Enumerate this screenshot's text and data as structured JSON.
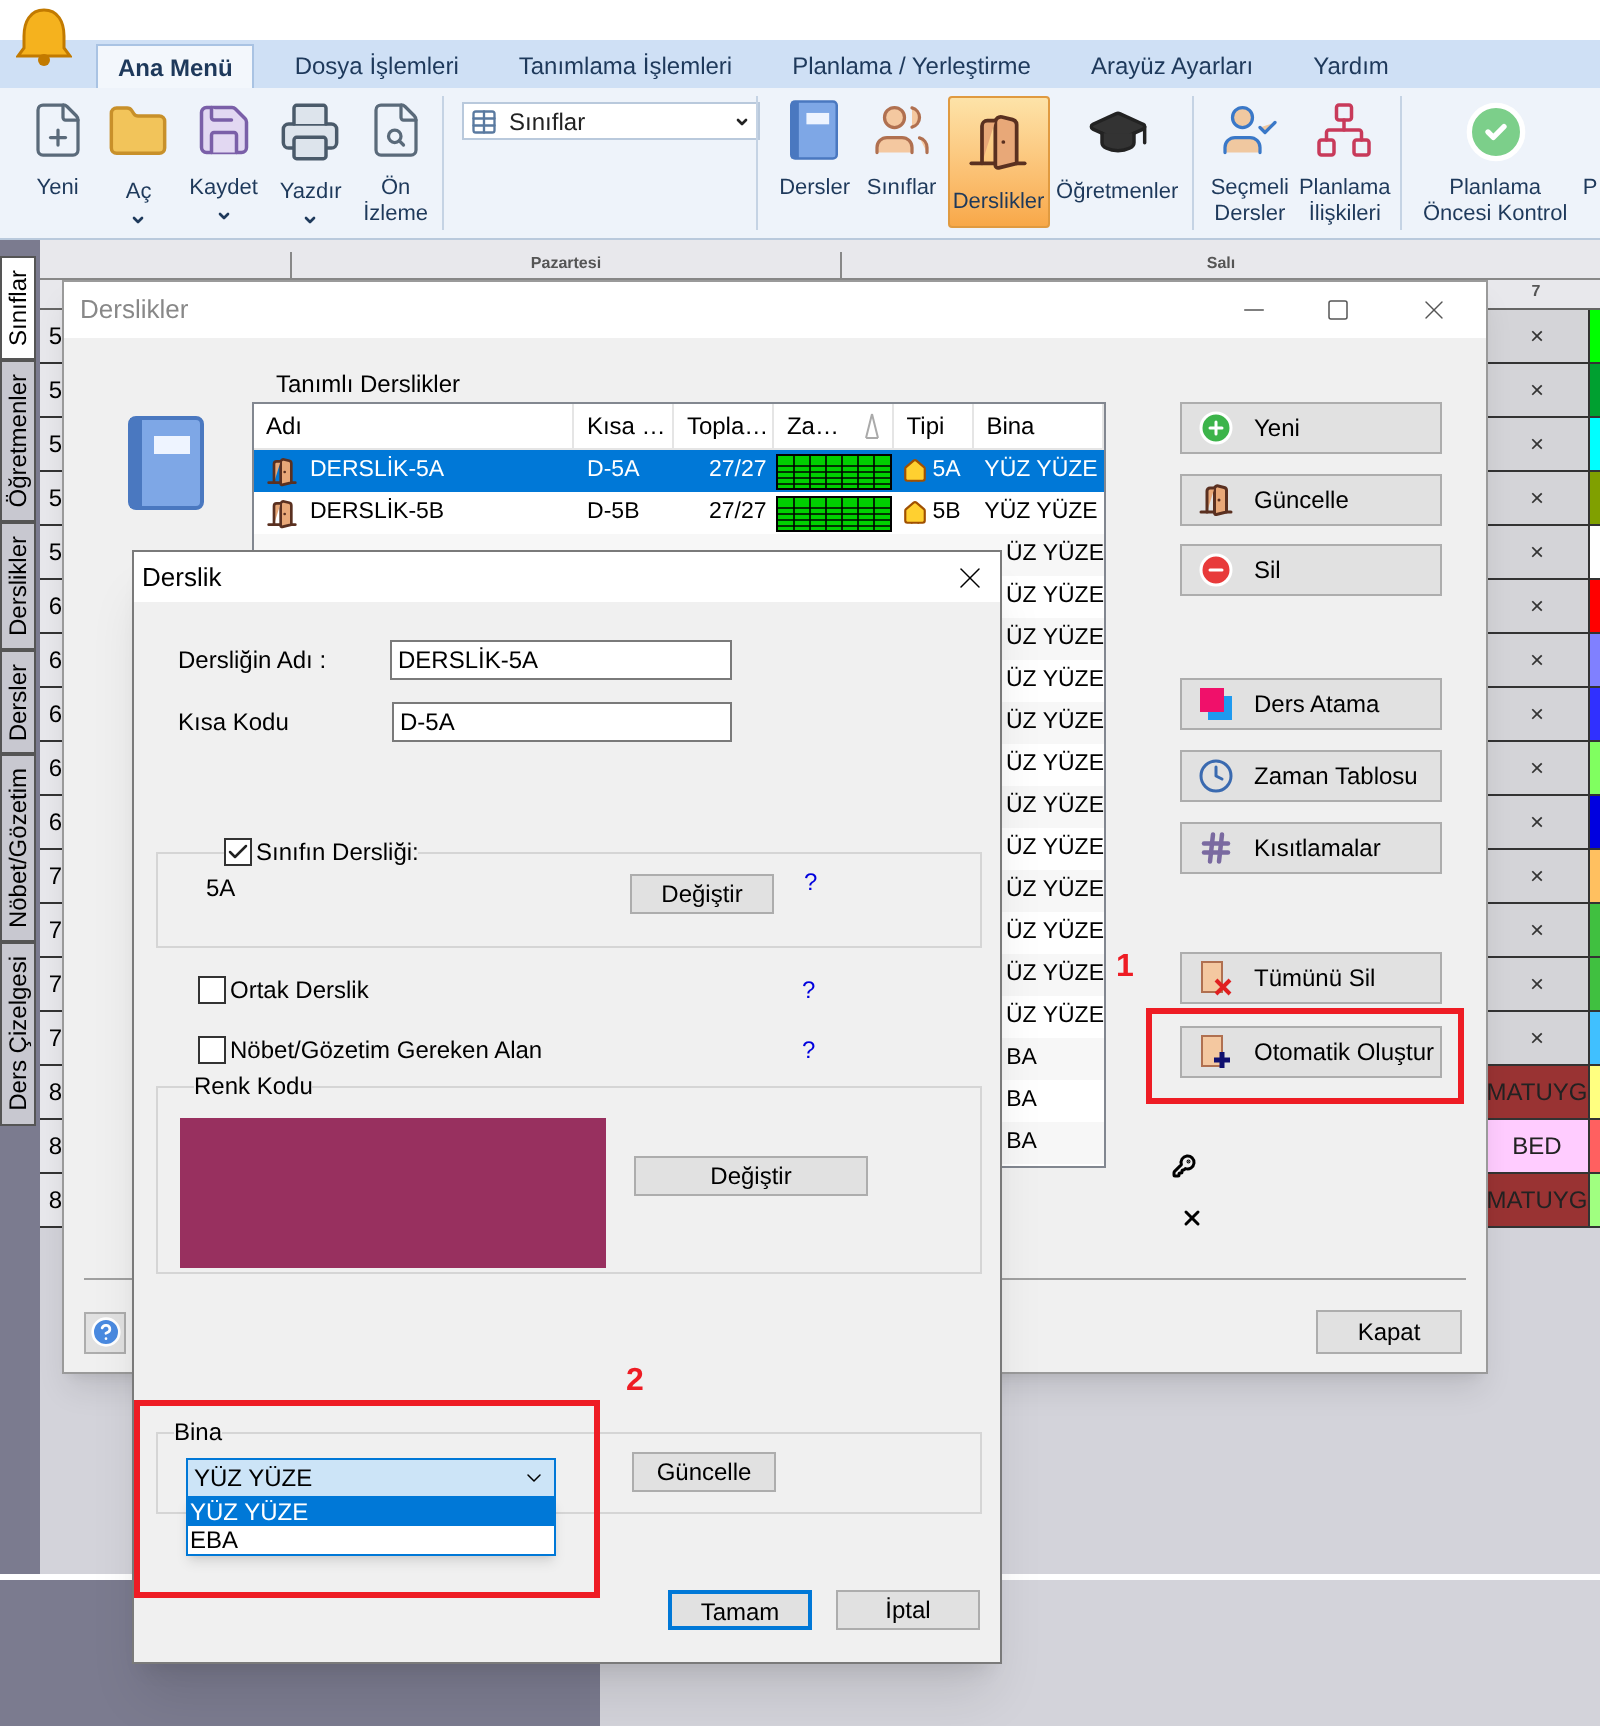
{
  "app_tabs": [
    {
      "label": "Ana Menü",
      "selected": true
    },
    {
      "label": "Dosya İşlemleri",
      "selected": false
    },
    {
      "label": "Tanımlama İşlemleri",
      "selected": false
    },
    {
      "label": "Planlama / Yerleştirme",
      "selected": false
    },
    {
      "label": "Arayüz Ayarları",
      "selected": false
    },
    {
      "label": "Yardım",
      "selected": false
    }
  ],
  "ribbon": {
    "file_tools": [
      {
        "label": "Yeni",
        "dropdown": false
      },
      {
        "label": "Aç",
        "dropdown": true
      },
      {
        "label": "Kaydet",
        "dropdown": true
      },
      {
        "label": "Yazdır",
        "dropdown": true
      },
      {
        "label": "Ön\nİzleme",
        "dropdown": false
      }
    ],
    "view_select": {
      "value": "Sınıflar"
    },
    "data_tools": [
      {
        "label": "Dersler",
        "selected": false
      },
      {
        "label": "Sınıflar",
        "selected": false
      },
      {
        "label": "Derslikler",
        "selected": true
      },
      {
        "label": "Öğretmenler",
        "selected": false
      }
    ],
    "plan_tools": [
      {
        "label": "Seçmeli\nDersler"
      },
      {
        "label": "Planlama\nİlişkileri"
      }
    ],
    "check_tools": [
      {
        "label": "Planlama\nÖncesi Kontrol"
      },
      {
        "label": "P"
      }
    ]
  },
  "side_tabs": [
    {
      "label": "Sınıflar",
      "selected": true
    },
    {
      "label": "Öğretmenler",
      "selected": false
    },
    {
      "label": "Derslikler",
      "selected": false
    },
    {
      "label": "Dersler",
      "selected": false
    },
    {
      "label": "Nöbet/Gözetim",
      "selected": false
    },
    {
      "label": "Ders Çizelgesi",
      "selected": false
    }
  ],
  "timetable": {
    "days": [
      "Pazartesi",
      "Salı"
    ],
    "period": "7",
    "rows": [
      {
        "number": "5",
        "kind": "empty",
        "cell": "×",
        "color": "#00ff00"
      },
      {
        "number": "5",
        "kind": "empty",
        "cell": "×",
        "color": "#00a030"
      },
      {
        "number": "5",
        "kind": "empty",
        "cell": "×",
        "color": "#00ffff"
      },
      {
        "number": "5",
        "kind": "empty",
        "cell": "×",
        "color": "#80a000"
      },
      {
        "number": "5",
        "kind": "empty",
        "cell": "×",
        "color": "#ffffff"
      },
      {
        "number": "6",
        "kind": "empty",
        "cell": "×",
        "color": "#ff0000"
      },
      {
        "number": "6",
        "kind": "empty",
        "cell": "×",
        "color": "#8080ff"
      },
      {
        "number": "6",
        "kind": "empty",
        "cell": "×",
        "color": "#3030ff"
      },
      {
        "number": "6",
        "kind": "empty",
        "cell": "×",
        "color": "#80ff60"
      },
      {
        "number": "6",
        "kind": "empty",
        "cell": "×",
        "color": "#0000e0"
      },
      {
        "number": "7",
        "kind": "empty",
        "cell": "×",
        "color": "#ffc060"
      },
      {
        "number": "7",
        "kind": "empty",
        "cell": "×",
        "color": "#40c040"
      },
      {
        "number": "7",
        "kind": "empty",
        "cell": "×",
        "color": "#40c040"
      },
      {
        "number": "7",
        "kind": "empty",
        "cell": "×",
        "color": "#40c0ff"
      },
      {
        "number": "8",
        "kind": "lesson",
        "cell": "MATUYG",
        "lesson": {
          "color": "#993333"
        },
        "color": "#ffff80"
      },
      {
        "number": "8",
        "kind": "lesson",
        "cell": "BED",
        "lesson": {
          "color": "#ffccff"
        },
        "color": "#ff6060"
      },
      {
        "number": "8",
        "kind": "lesson",
        "cell": "MATUYG",
        "lesson": {
          "color": "#993333"
        },
        "color": "#a0ff80"
      }
    ]
  },
  "rooms_window": {
    "title": "Derslikler",
    "list_label": "Tanımlı Derslikler",
    "columns": [
      "Adı",
      "Kısa …",
      "Topla…",
      "Za…",
      "Tipi",
      "Bina"
    ],
    "rows": [
      {
        "name": "DERSLİK-5A",
        "short": "D-5A",
        "total": "27/27",
        "type": "5A",
        "building": "YÜZ YÜZE",
        "selected": true
      },
      {
        "name": "DERSLİK-5B",
        "short": "D-5B",
        "total": "27/27",
        "type": "5B",
        "building": "YÜZ YÜZE",
        "selected": false
      },
      {
        "building": "ÜZ YÜZE",
        "selected": false
      },
      {
        "building": "ÜZ YÜZE",
        "selected": false
      },
      {
        "building": "ÜZ YÜZE",
        "selected": false
      },
      {
        "building": "ÜZ YÜZE",
        "selected": false
      },
      {
        "building": "ÜZ YÜZE",
        "selected": false
      },
      {
        "building": "ÜZ YÜZE",
        "selected": false
      },
      {
        "building": "ÜZ YÜZE",
        "selected": false
      },
      {
        "building": "ÜZ YÜZE",
        "selected": false
      },
      {
        "building": "ÜZ YÜZE",
        "selected": false
      },
      {
        "building": "ÜZ YÜZE",
        "selected": false
      },
      {
        "building": "ÜZ YÜZE",
        "selected": false
      },
      {
        "building": "ÜZ YÜZE",
        "selected": false
      },
      {
        "building": "BA",
        "selected": false
      },
      {
        "building": "BA",
        "selected": false
      },
      {
        "building": "BA",
        "selected": false
      }
    ],
    "buttons": [
      "Yeni",
      "Güncelle",
      "Sil",
      "Ders Atama",
      "Zaman Tablosu",
      "Kısıtlamalar",
      "Tümünü Sil",
      "Otomatik Oluştur"
    ],
    "close_button": "Kapat"
  },
  "room_dialog": {
    "title": "Derslik",
    "name_label": "Dersliğin Adı :",
    "name_value": "DERSLİK-5A",
    "code_label": "Kısa Kodu",
    "code_value": "D-5A",
    "class_room": {
      "label": "Sınıfın Dersliği:",
      "checked": true,
      "value": "5A",
      "button": "Değiştir",
      "help": "?"
    },
    "options": [
      {
        "label": "Ortak Derslik",
        "checked": false,
        "help": "?"
      },
      {
        "label": "Nöbet/Gözetim Gereken Alan",
        "checked": false,
        "help": "?"
      }
    ],
    "color_code": {
      "label": "Renk Kodu",
      "color": "#98305f",
      "button": "Değiştir"
    },
    "building": {
      "label": "Bina",
      "value": "YÜZ YÜZE",
      "options": [
        {
          "label": "YÜZ YÜZE",
          "selected": true
        },
        {
          "label": "EBA",
          "selected": false
        }
      ],
      "button": "Güncelle"
    },
    "buttons": [
      {
        "label": "Tamam",
        "default": true
      },
      {
        "label": "İptal",
        "default": false
      }
    ]
  },
  "annotations": [
    {
      "text": "1"
    },
    {
      "text": "2"
    }
  ]
}
